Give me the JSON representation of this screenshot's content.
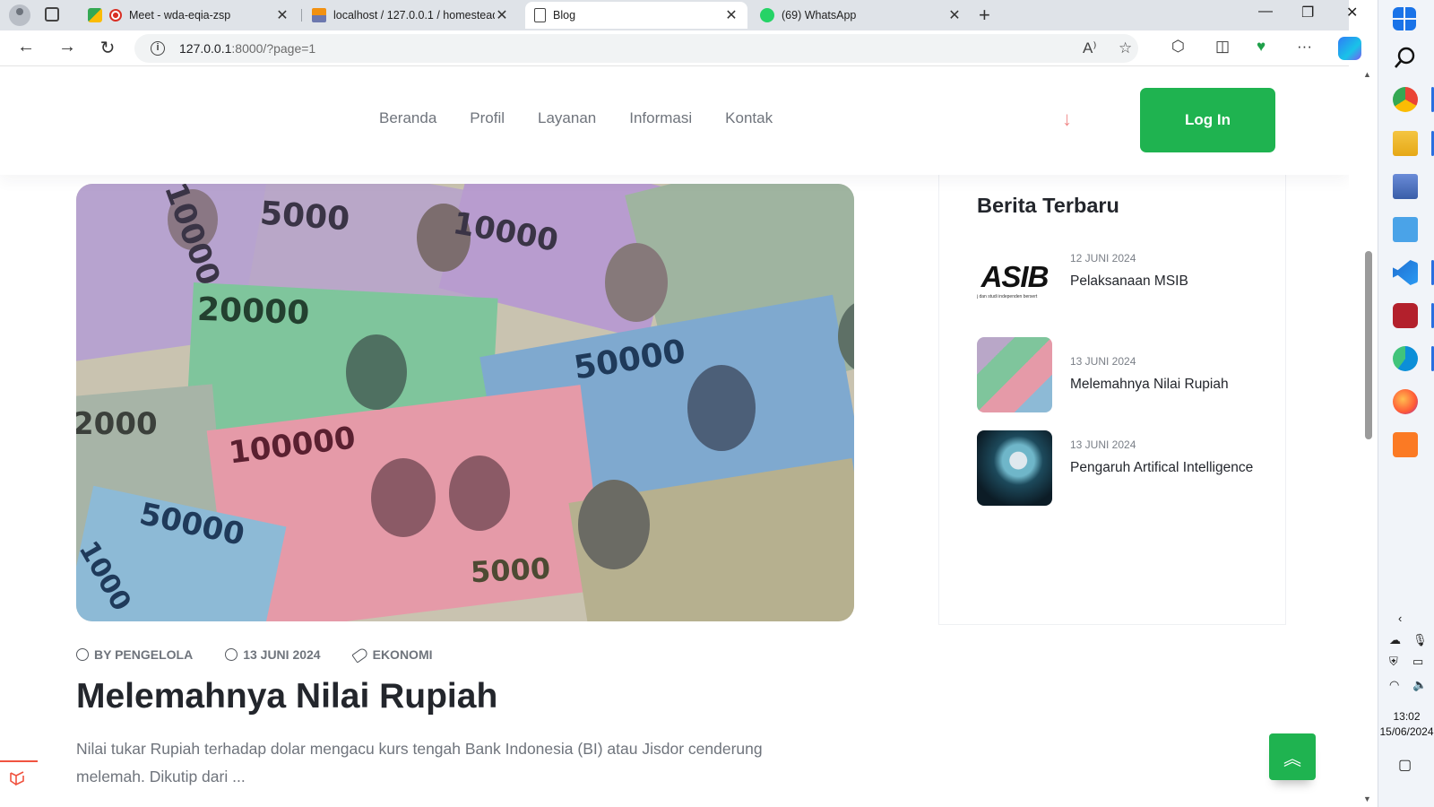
{
  "browser": {
    "tabs": [
      {
        "title": "Meet - wda-eqia-zsp",
        "active": false,
        "favicon": "google-meet-icon"
      },
      {
        "title": "localhost / 127.0.0.1 / homestead",
        "active": false,
        "favicon": "phpmyadmin-icon"
      },
      {
        "title": "Blog",
        "active": true,
        "favicon": "page-icon"
      },
      {
        "title": "(69) WhatsApp",
        "active": false,
        "favicon": "whatsapp-icon"
      }
    ],
    "address": {
      "host": "127.0.0.1",
      "path": ":8000/?page=1"
    },
    "accent": "#1a73e8"
  },
  "site": {
    "menu": [
      "Beranda",
      "Profil",
      "Layanan",
      "Informasi",
      "Kontak"
    ],
    "login_label": "Log In",
    "brand_green": "#1fb350"
  },
  "post": {
    "author": "BY PENGELOLA",
    "date": "13 JUNI 2024",
    "category": "EKONOMI",
    "title": "Melemahnya Nilai Rupiah",
    "excerpt": "Nilai tukar Rupiah terhadap dolar mengacu kurs tengah Bank Indonesia (BI) atau Jisdor cenderung melemah. Dikutip dari ...",
    "banknote_values": [
      "5000",
      "10000",
      "20000",
      "50000",
      "100000",
      "2000",
      "50000",
      "5000",
      "1000",
      "10000"
    ]
  },
  "sidebar": {
    "title": "Berita Terbaru",
    "items": [
      {
        "date": "12 JUNI 2024",
        "title": "Pelaksanaan MSIB",
        "thumb_text": "ASIB",
        "thumb_caption": "j dan studi independen bersert"
      },
      {
        "date": "13 JUNI 2024",
        "title": "Melemahnya Nilai Rupiah"
      },
      {
        "date": "13 JUNI 2024",
        "title": "Pengaruh Artifical Intelligence"
      }
    ]
  },
  "taskbar": {
    "time": "13:02",
    "date": "15/06/2024"
  }
}
